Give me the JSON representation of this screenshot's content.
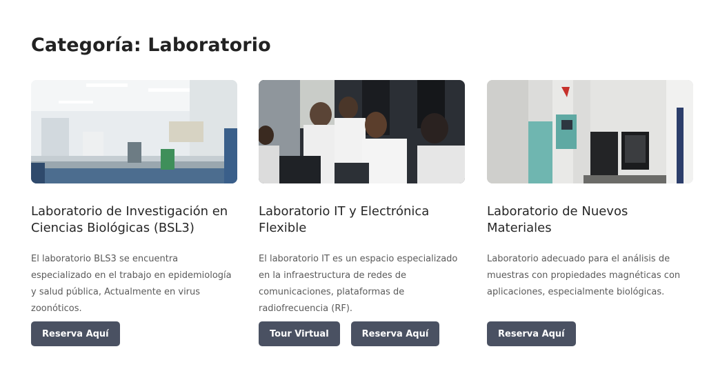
{
  "page": {
    "title": "Categoría: Laboratorio"
  },
  "cards": [
    {
      "image_alt": "laboratory-photo",
      "title": "Laboratorio de Investigación en Ciencias Biológicas (BSL3)",
      "description": "El laboratorio BLS3 se encuentra especializado en el trabajo en epidemiología y salud pública, Actualmente en virus zoonóticos.",
      "buttons": [
        "Reserva Aquí"
      ]
    },
    {
      "image_alt": "students-in-it-lab-photo",
      "title": "Laboratorio IT y Electrónica Flexible",
      "description": "El laboratorio IT es un espacio especializado en la infraestructura de redes de comunicaciones, plataformas de radiofrecuencia (RF).",
      "buttons": [
        "Tour Virtual",
        "Reserva Aquí"
      ]
    },
    {
      "image_alt": "materials-testing-machine-photo",
      "title": "Laboratorio de Nuevos Materiales",
      "description": "Laboratorio adecuado para el análisis de muestras con propiedades magnéticas con aplicaciones, especialmente biológicas.",
      "buttons": [
        "Reserva Aquí"
      ]
    }
  ],
  "colors": {
    "button_bg": "#4a5162",
    "title": "#222222",
    "text": "#5a5a5a"
  }
}
